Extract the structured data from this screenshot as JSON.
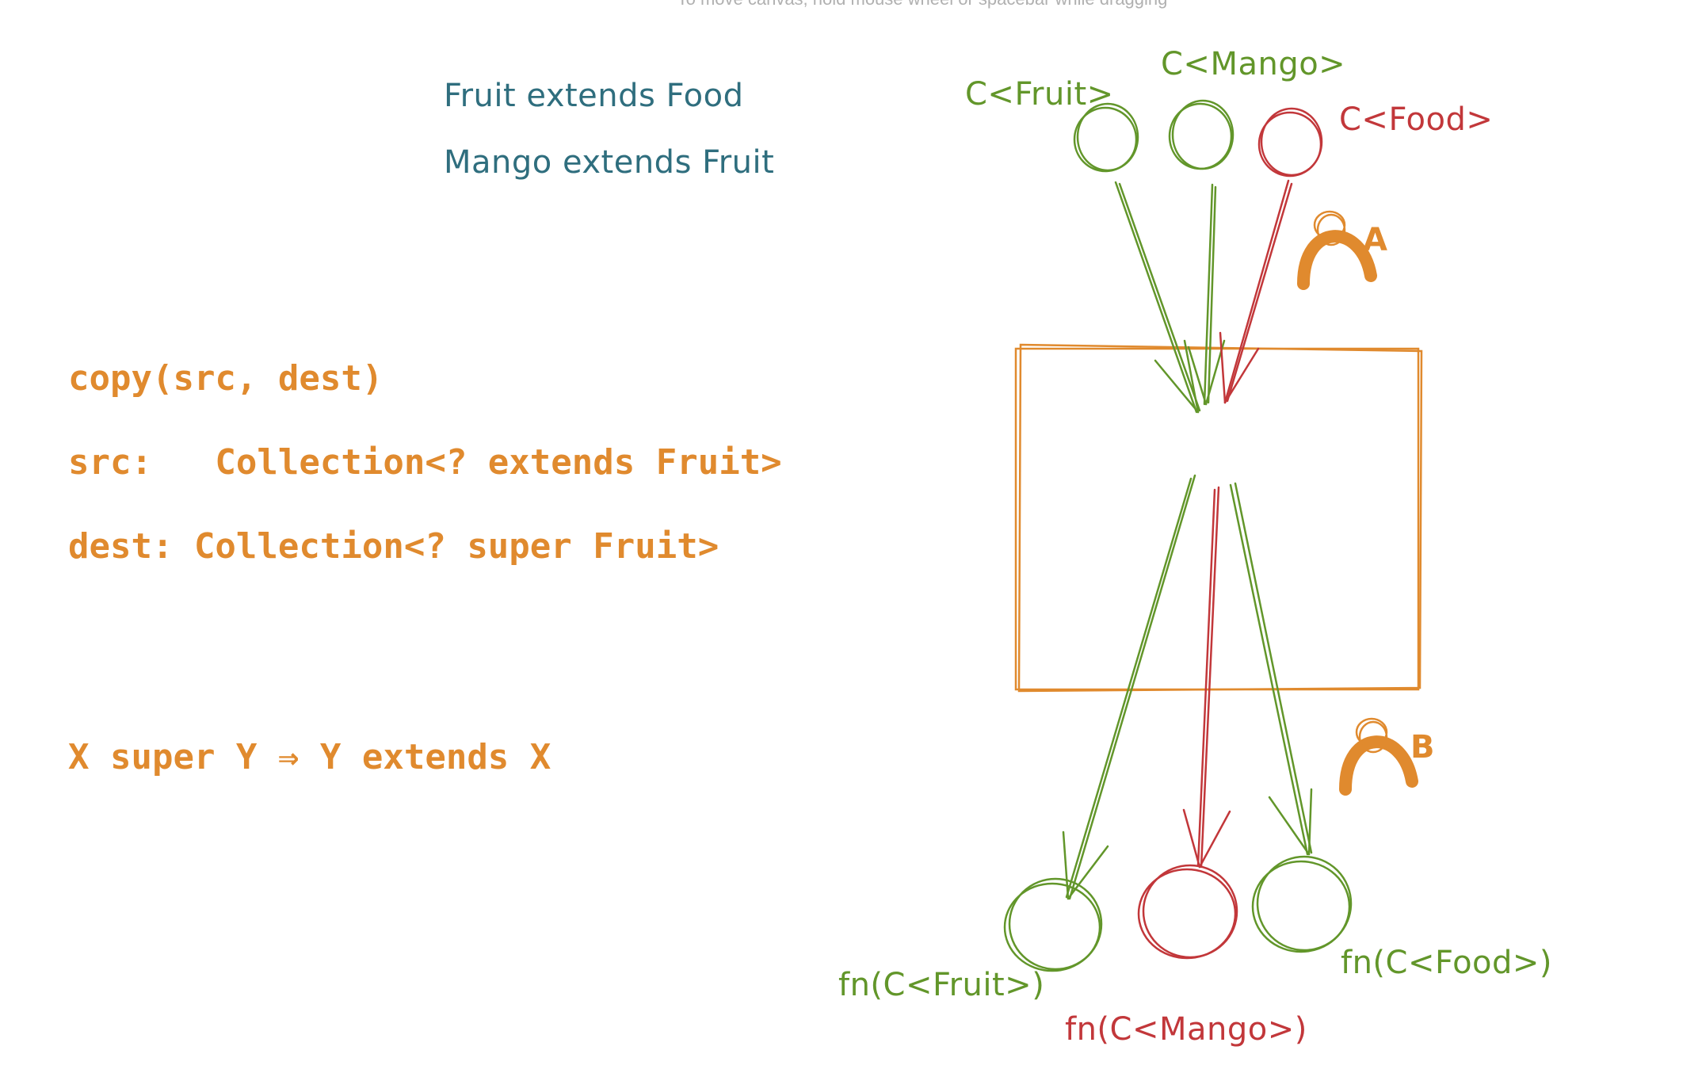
{
  "hint": "To move canvas, hold mouse wheel or spacebar while dragging",
  "relations": {
    "line1": "Fruit extends Food",
    "line2": "Mango extends Fruit"
  },
  "code": {
    "line1": "copy(src, dest)",
    "line2": "src:   Collection<? extends Fruit>",
    "line3": "dest: Collection<? super Fruit>",
    "line4": "X super Y ⇒ Y extends X"
  },
  "inputs": {
    "fruit": "C<Fruit>",
    "mango": "C<Mango>",
    "food": "C<Food>"
  },
  "outputs": {
    "fruit": "fn(C<Fruit>)",
    "mango": "fn(C<Mango>)",
    "food": "fn(C<Food>)"
  },
  "markers": {
    "a": "A",
    "b": "B"
  },
  "colors": {
    "green": "#62962a",
    "red": "#c2373a",
    "orange": "#e08a2e",
    "teal": "#2f6e7e"
  }
}
